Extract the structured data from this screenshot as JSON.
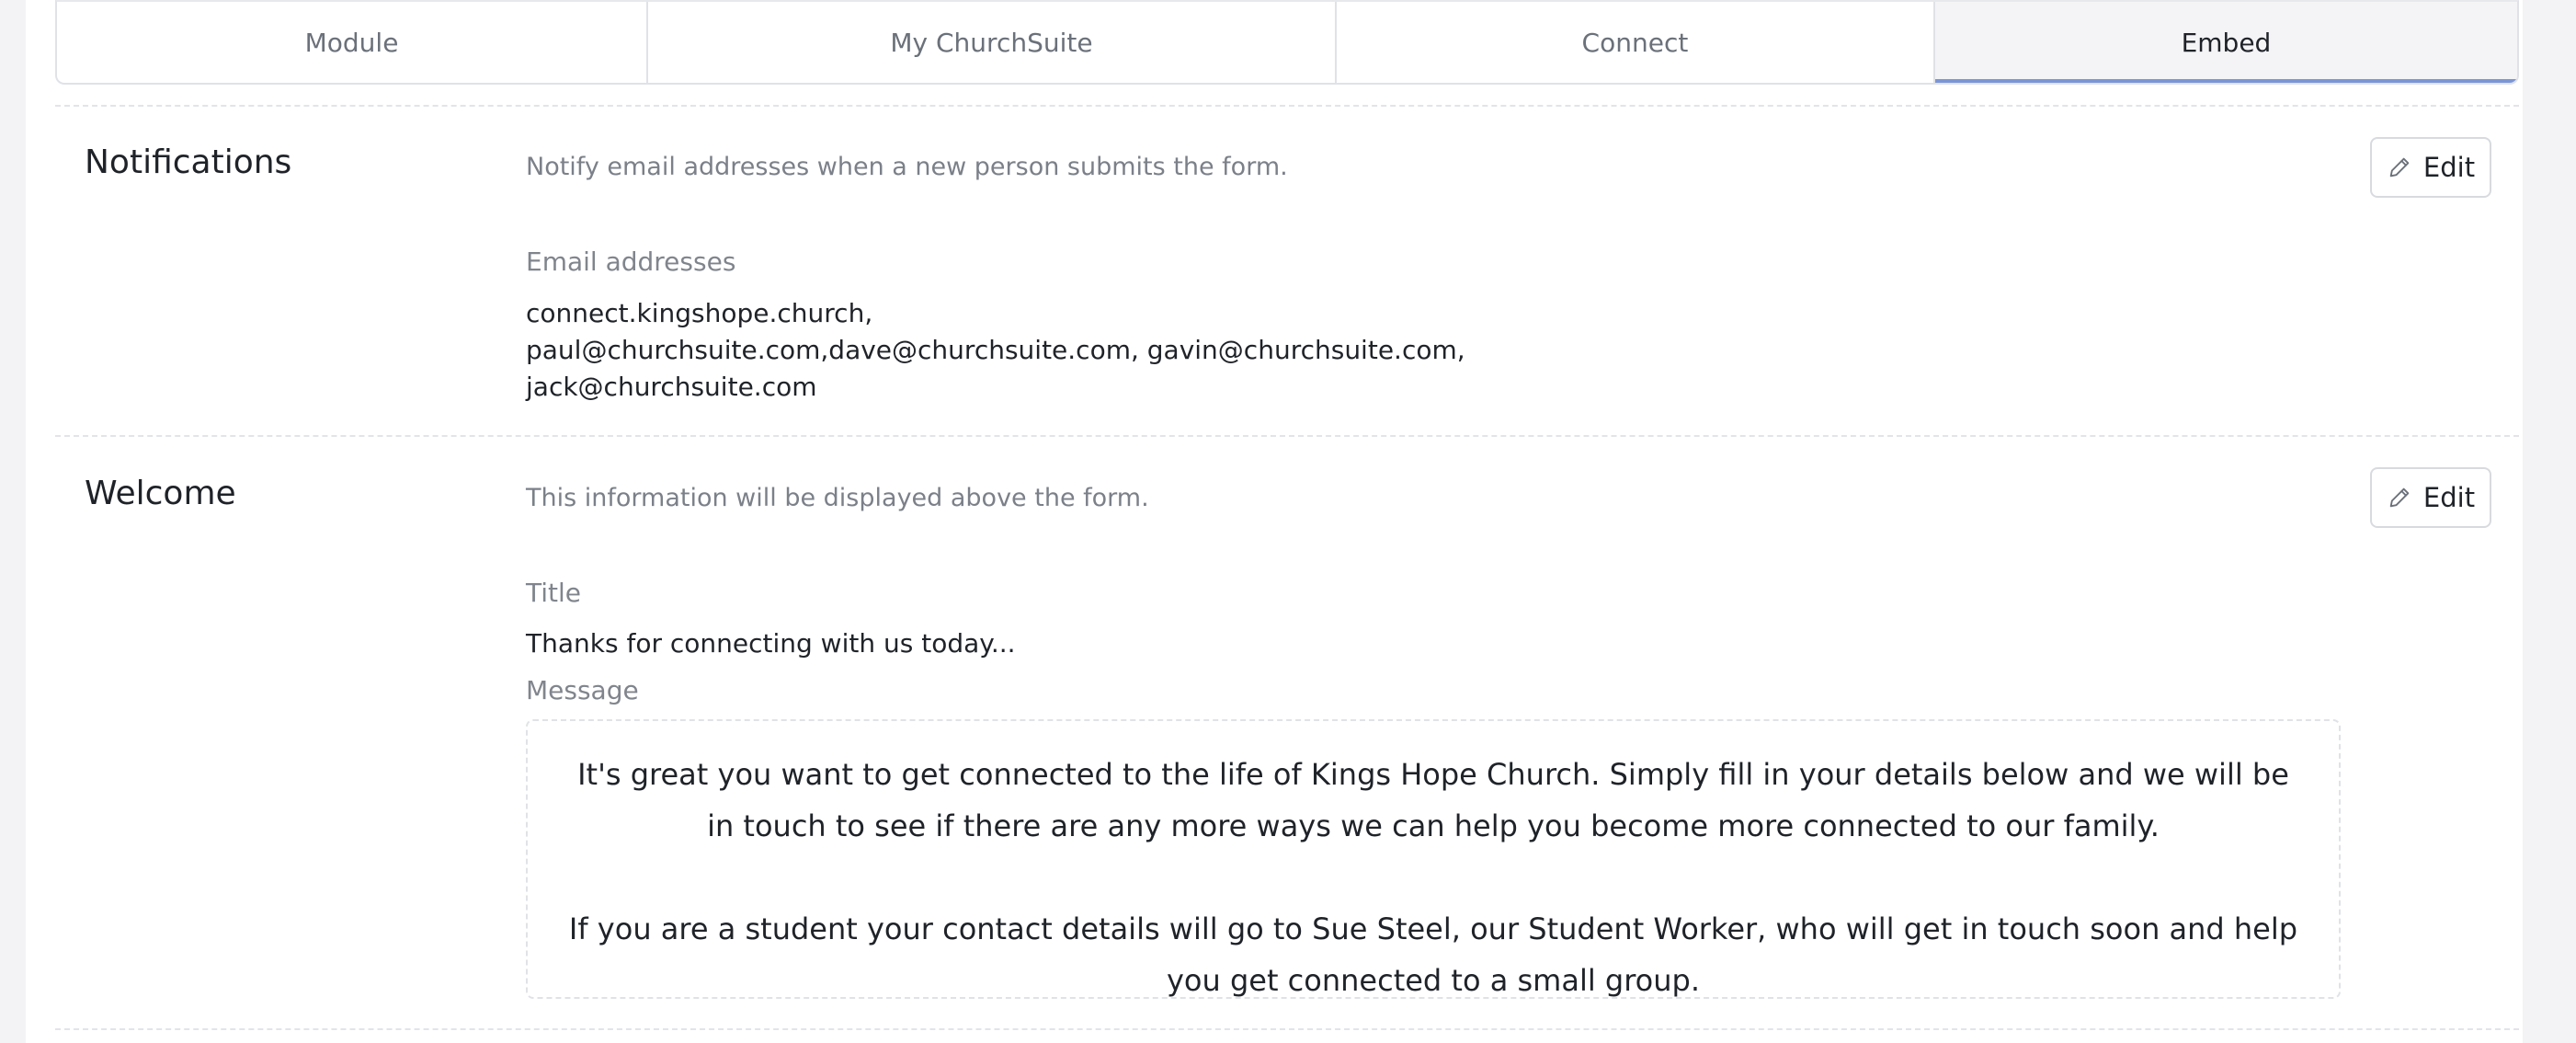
{
  "tabs": [
    {
      "label": "Module",
      "active": false
    },
    {
      "label": "My ChurchSuite",
      "active": false
    },
    {
      "label": "Connect",
      "active": false
    },
    {
      "label": "Embed",
      "active": true
    }
  ],
  "notifications": {
    "title": "Notifications",
    "description": "Notify email addresses when a new person submits the form.",
    "edit_label": "Edit",
    "email_label": "Email addresses",
    "email_lines": [
      "connect.kingshope.church,",
      "paul@churchsuite.com,dave@churchsuite.com, gavin@churchsuite.com,",
      "jack@churchsuite.com"
    ]
  },
  "welcome": {
    "title": "Welcome",
    "description": "This information will be displayed above the form.",
    "edit_label": "Edit",
    "title_label": "Title",
    "title_value": "Thanks for connecting with us today...",
    "message_label": "Message",
    "message_paragraphs": [
      "It's great you want to get connected to the life of Kings Hope Church. Simply fill in your details below and we will be in touch to see if there are any more ways we can help you become more connected to our family.",
      "If you are a student your contact details will go to Sue Steel, our Student Worker, who will get in touch soon and help you get connected to a small group."
    ]
  },
  "icons": {
    "edit": "pencil-icon"
  }
}
